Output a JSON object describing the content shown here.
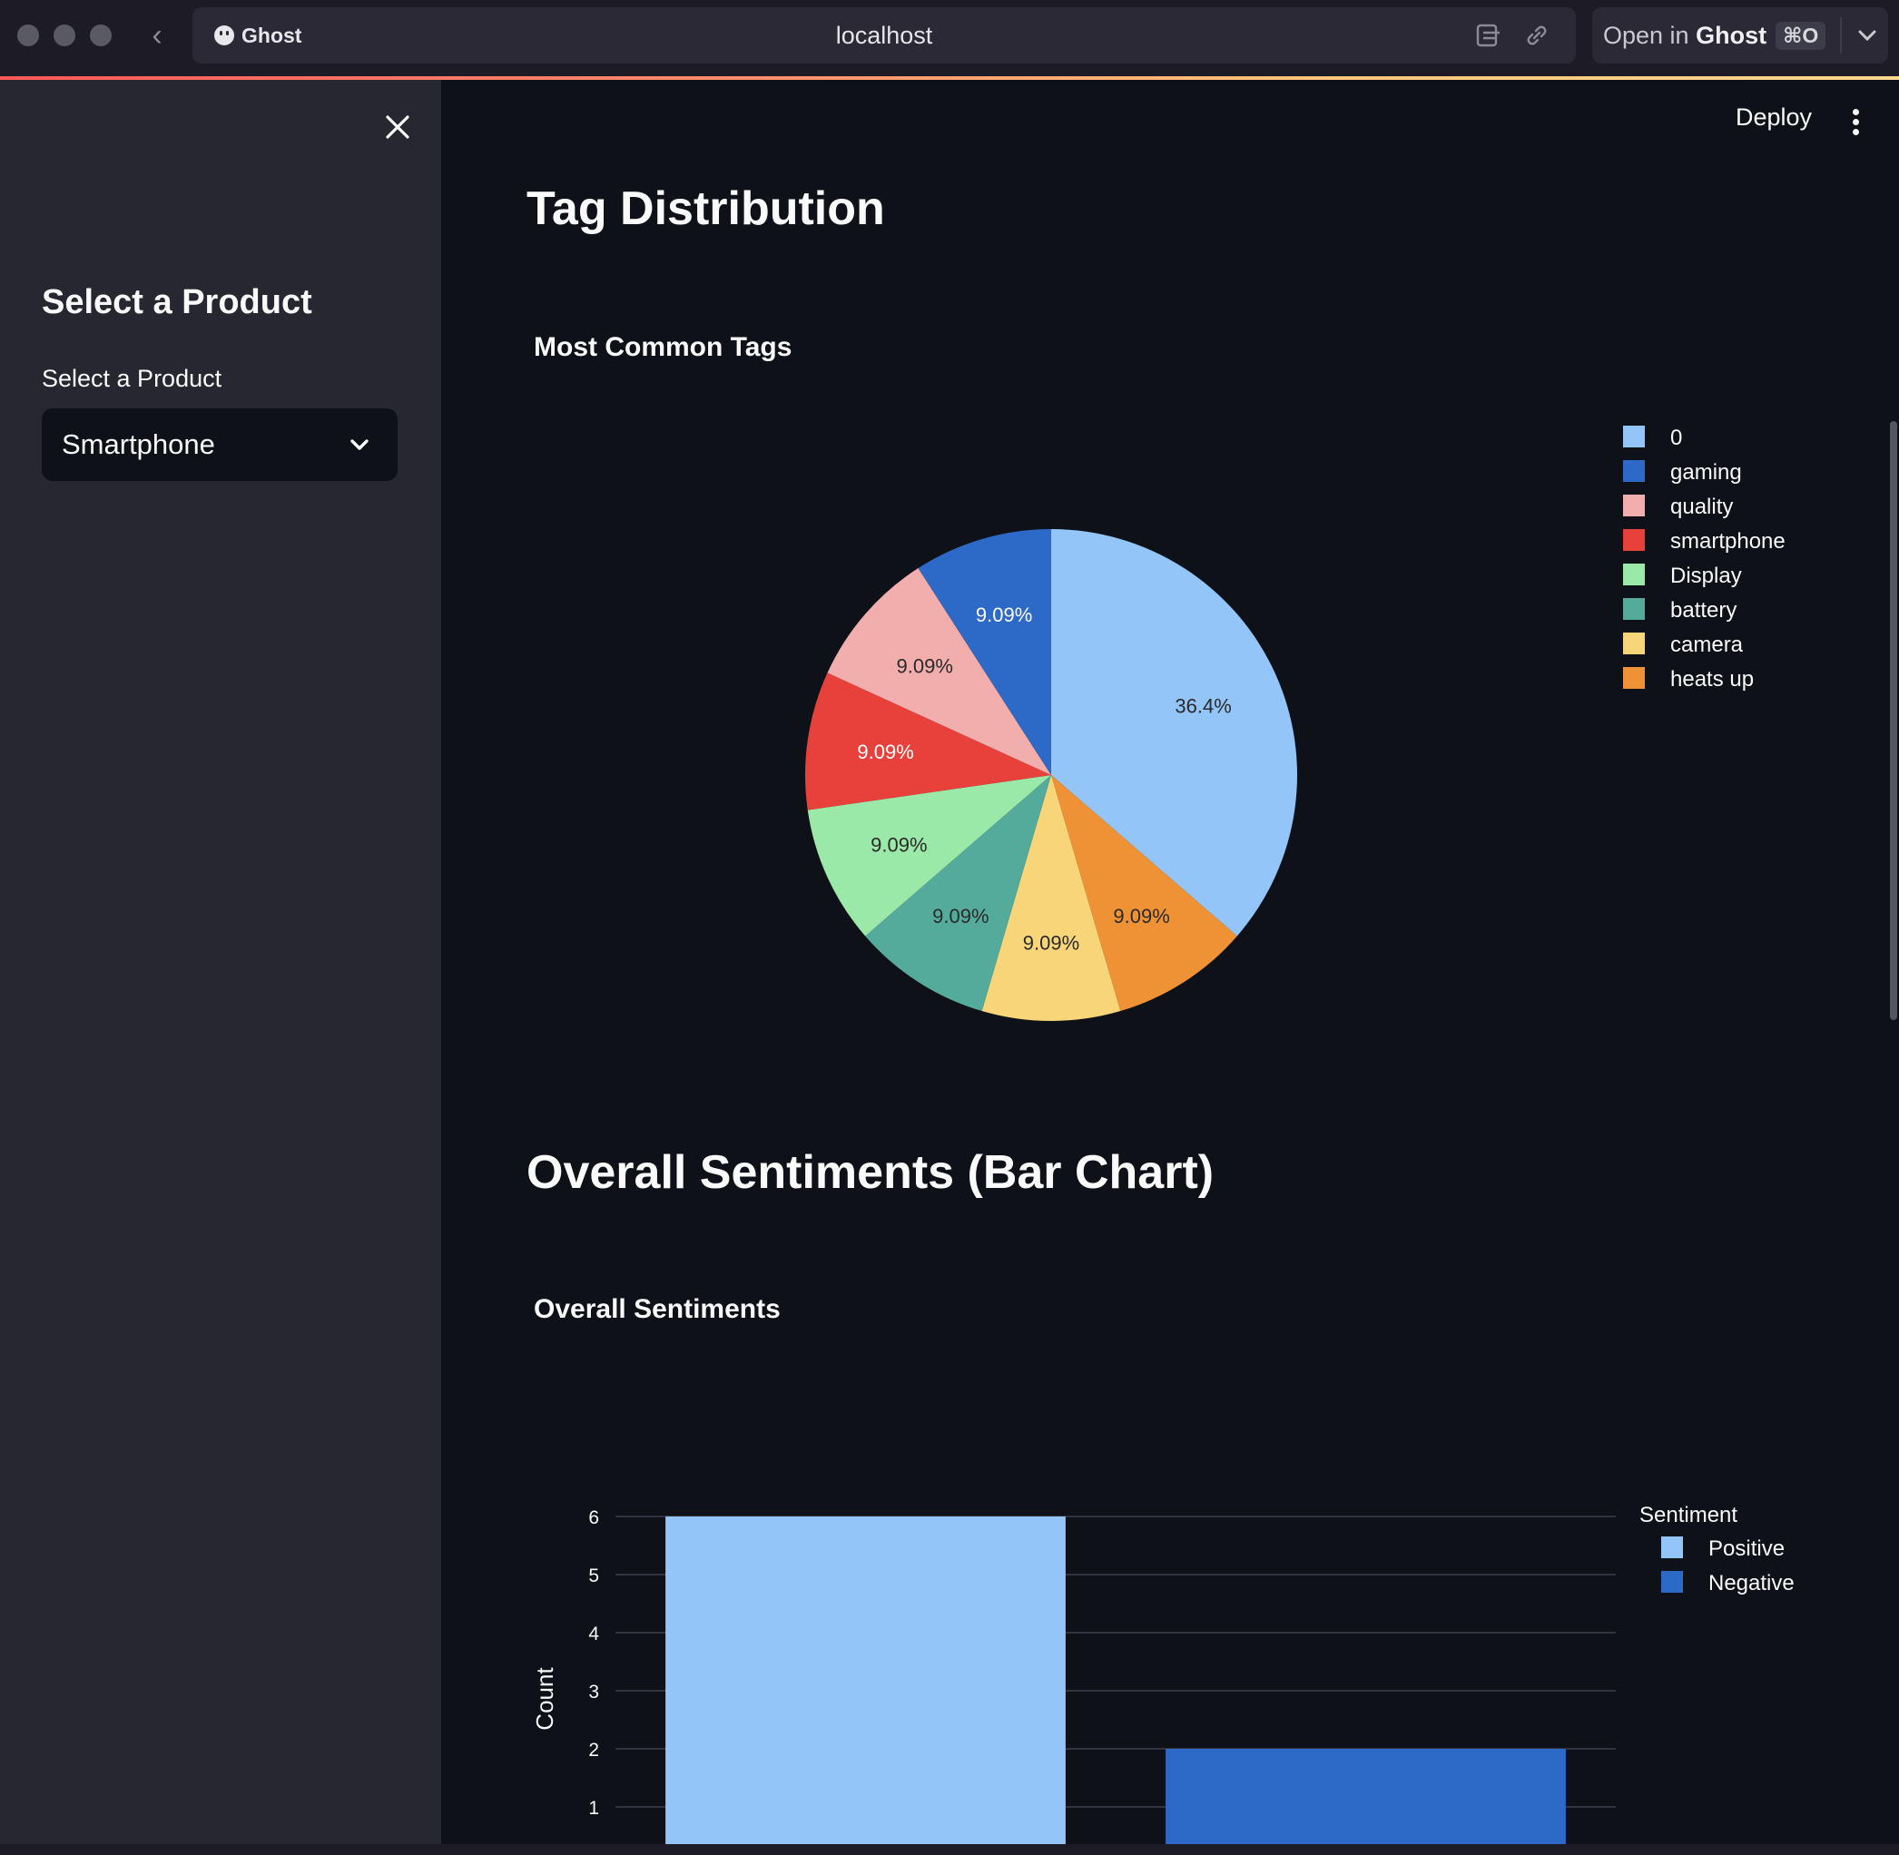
{
  "browser": {
    "app_name": "Ghost",
    "url": "localhost",
    "open_in_prefix": "Open in",
    "open_in_app": "Ghost",
    "shortcut": "⌘O"
  },
  "sidebar": {
    "heading": "Select a Product",
    "select_label": "Select a Product",
    "select_value": "Smartphone"
  },
  "header": {
    "deploy_label": "Deploy"
  },
  "sections": {
    "tag_heading": "Tag Distribution",
    "tag_chart_title": "Most Common Tags",
    "sentiment_heading": "Overall Sentiments (Bar Chart)",
    "sentiment_chart_title": "Overall Sentiments"
  },
  "colors": {
    "background": "#0e1117",
    "sidebar": "#262730",
    "text": "#fafafa"
  },
  "chart_data": [
    {
      "type": "pie",
      "title": "Most Common Tags",
      "labels": [
        "0",
        "gaming",
        "quality",
        "smartphone",
        "Display",
        "battery",
        "camera",
        "heats up"
      ],
      "values": [
        4,
        1,
        1,
        1,
        1,
        1,
        1,
        1
      ],
      "percent_labels": [
        "36.4%",
        "9.09%",
        "9.09%",
        "9.09%",
        "9.09%",
        "9.09%",
        "9.09%",
        "9.09%"
      ],
      "colors": [
        "#93c5f8",
        "#2d69c7",
        "#f2adad",
        "#e8403b",
        "#9be9a8",
        "#54ab9c",
        "#f8d579",
        "#ef9135"
      ],
      "draw_order": [
        0,
        7,
        6,
        5,
        4,
        3,
        2,
        1
      ],
      "legend_position": "right"
    },
    {
      "type": "bar",
      "title": "Overall Sentiments",
      "categories": [
        "Positive",
        "Negative"
      ],
      "values": [
        6,
        2
      ],
      "colors": [
        "#93c5f8",
        "#2d69c7"
      ],
      "ylabel": "Count",
      "yticks": [
        1,
        2,
        3,
        4,
        5,
        6
      ],
      "ylim": [
        0,
        6.3
      ],
      "legend_title": "Sentiment",
      "legend_position": "top-right",
      "grid": true
    }
  ]
}
